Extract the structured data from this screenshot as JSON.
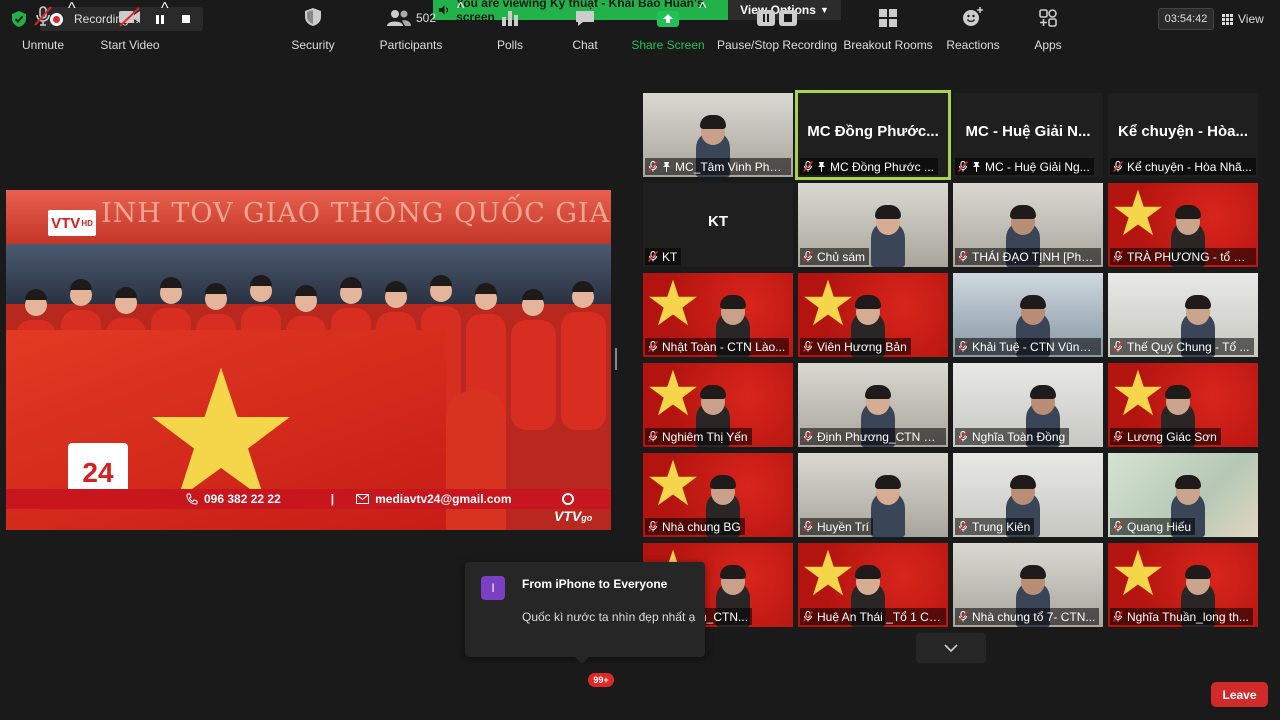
{
  "recording": {
    "label": "Recording..."
  },
  "banner": {
    "viewing_text": "You are viewing Kỹ thuật - Khải Bảo Huấn's screen",
    "view_options": "View Options"
  },
  "timer": "03:54:42",
  "view_button": "View",
  "shared_screen": {
    "banner_text": "INH TOV GIAO THÔNG QUỐC GIA",
    "channel_logo": "VTV",
    "channel_sub": "HD",
    "logo_24": "24",
    "phone": "096 382 22 22",
    "separator": "|",
    "email": "mediavtv24@gmail.com",
    "watermark": "VTV",
    "watermark_sub": "go"
  },
  "participants": [
    {
      "name": "MC_Tâm Vinh Phong",
      "pinned": true,
      "bg": "room",
      "big_name": ""
    },
    {
      "name": "MC Đồng Phước ...",
      "pinned": true,
      "bg": "dark",
      "big_name": "MC Đồng Phước...",
      "active": true
    },
    {
      "name": "MC - Huệ Giải Ng...",
      "pinned": true,
      "bg": "dark",
      "big_name": "MC - Huệ Giải N..."
    },
    {
      "name": "Kể chuyện - Hòa Nhã...",
      "pinned": false,
      "bg": "dark",
      "big_name": "Kể chuyện - Hòa..."
    },
    {
      "name": "KT",
      "pinned": false,
      "bg": "dark",
      "big_name": "KT"
    },
    {
      "name": "Chủ sám",
      "pinned": false,
      "bg": "room",
      "big_name": ""
    },
    {
      "name": "THÁI ĐẠO TỊNH [Phật...",
      "pinned": false,
      "bg": "room",
      "big_name": ""
    },
    {
      "name": "TRÀ PHƯƠNG - tổ 1 ...",
      "pinned": false,
      "bg": "flag",
      "big_name": ""
    },
    {
      "name": "Nhật Toàn - CTN Lào...",
      "pinned": false,
      "bg": "flag",
      "big_name": ""
    },
    {
      "name": "Viên Hương Bản",
      "pinned": false,
      "bg": "flag",
      "big_name": ""
    },
    {
      "name": "Khải Tuệ - CTN Vũng ...",
      "pinned": false,
      "bg": "blue",
      "big_name": ""
    },
    {
      "name": "Thế Quý Chung - Tổ ...",
      "pinned": false,
      "bg": "wall",
      "big_name": ""
    },
    {
      "name": "Nghiêm Thị Yến",
      "pinned": false,
      "bg": "flag",
      "big_name": ""
    },
    {
      "name": "Định Phương_CTN H...",
      "pinned": false,
      "bg": "room",
      "big_name": ""
    },
    {
      "name": "Nghĩa Toàn Đồng",
      "pinned": false,
      "bg": "wall",
      "big_name": ""
    },
    {
      "name": "Lương Giác Sơn",
      "pinned": false,
      "bg": "flag",
      "big_name": ""
    },
    {
      "name": "Nhà chung BG",
      "pinned": false,
      "bg": "flag",
      "big_name": ""
    },
    {
      "name": "Huyền Trí",
      "pinned": false,
      "bg": "room",
      "big_name": ""
    },
    {
      "name": "Trung Kiên",
      "pinned": false,
      "bg": "wall",
      "big_name": ""
    },
    {
      "name": "Quang Hiếu",
      "pinned": false,
      "bg": "map",
      "big_name": ""
    },
    {
      "name": "ng Niệm_CTN...",
      "pinned": false,
      "bg": "flag",
      "big_name": ""
    },
    {
      "name": "Huệ An Thái _Tổ 1 CT...",
      "pinned": false,
      "bg": "flag",
      "big_name": ""
    },
    {
      "name": "Nhà chung tổ 7- CTN...",
      "pinned": false,
      "bg": "room",
      "big_name": ""
    },
    {
      "name": "Nghĩa Thuần_long th...",
      "pinned": false,
      "bg": "flag",
      "big_name": ""
    }
  ],
  "chat_popup": {
    "avatar_letter": "I",
    "from": "From iPhone to Everyone",
    "message": "Quốc kì nước ta nhìn đẹp nhất ạ"
  },
  "toolbar": {
    "unmute": "Unmute",
    "start_video": "Start Video",
    "security": "Security",
    "participants": "Participants",
    "participant_count": "502",
    "polls": "Polls",
    "chat": "Chat",
    "chat_badge": "99+",
    "share_screen": "Share Screen",
    "pause_stop_recording": "Pause/Stop Recording",
    "breakout_rooms": "Breakout Rooms",
    "reactions": "Reactions",
    "apps": "Apps",
    "leave": "Leave"
  },
  "colors": {
    "accent_green": "#21b34a",
    "active_speaker": "#a9d34b",
    "danger_red": "#d12a2a",
    "chat_badge": "#e02828"
  }
}
